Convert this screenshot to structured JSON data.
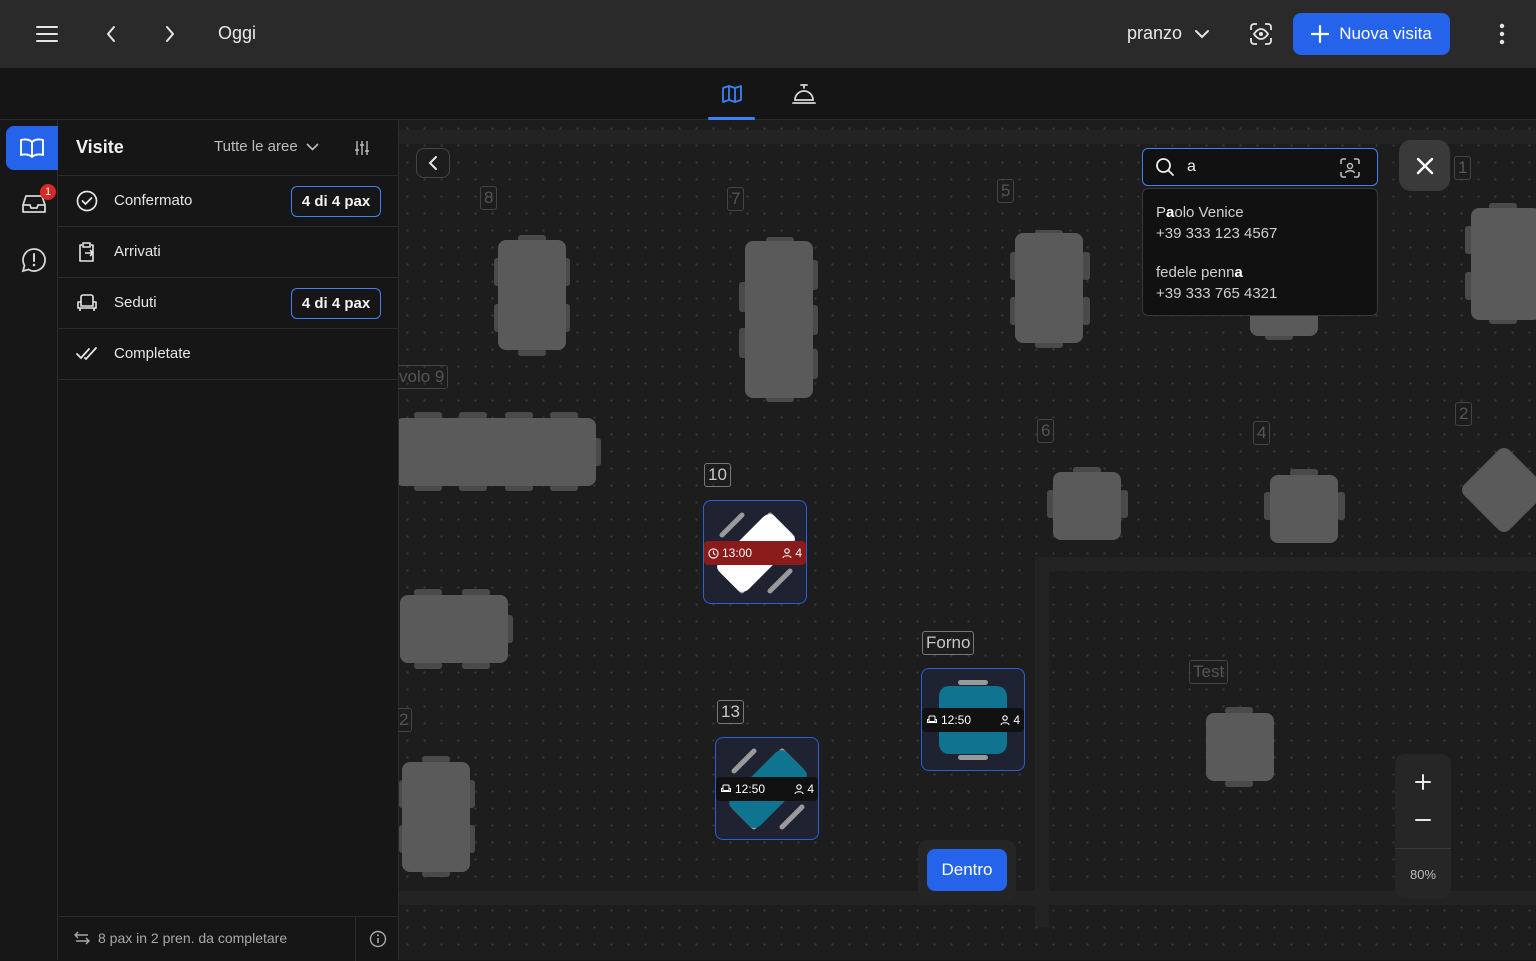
{
  "topbar": {
    "date_label": "Oggi",
    "service": "pranzo",
    "new_visit_label": "Nuova visita"
  },
  "rail": {
    "inbox_badge": "1"
  },
  "panel": {
    "title": "Visite",
    "area_filter": "Tutte le aree",
    "rows": [
      {
        "label": "Confermato",
        "chip": "4 di 4 pax"
      },
      {
        "label": "Arrivati",
        "chip": ""
      },
      {
        "label": "Seduti",
        "chip": "4 di 4 pax"
      },
      {
        "label": "Completate",
        "chip": ""
      }
    ],
    "footer": "8 pax in 2 pren. da completare"
  },
  "floor": {
    "table_labels": {
      "t8": "8",
      "t7": "7",
      "t5": "5",
      "t1": "1",
      "t9": "volo 9",
      "t10": "10",
      "t6": "6",
      "t4": "4",
      "t2": "2",
      "t13": "13",
      "forno": "Forno",
      "test": "Test",
      "t2b": "2"
    },
    "booking_t10": {
      "time": "13:00",
      "pax": "4",
      "color": "#8b1a1a"
    },
    "booking_t13": {
      "time": "12:50",
      "pax": "4",
      "color": "#0e7490"
    },
    "booking_forno": {
      "time": "12:50",
      "pax": "4",
      "color": "#0e7490"
    },
    "dentro_label": "Dentro",
    "zoom_level": "80%"
  },
  "search": {
    "query": "a",
    "results": [
      {
        "name_pre": "P",
        "name_hl": "a",
        "name_post": "olo Venice",
        "phone": "+39 333 123 4567"
      },
      {
        "name_pre": "fedele penn",
        "name_hl": "a",
        "name_post": "",
        "phone": "+39 333 765 4321"
      }
    ]
  }
}
